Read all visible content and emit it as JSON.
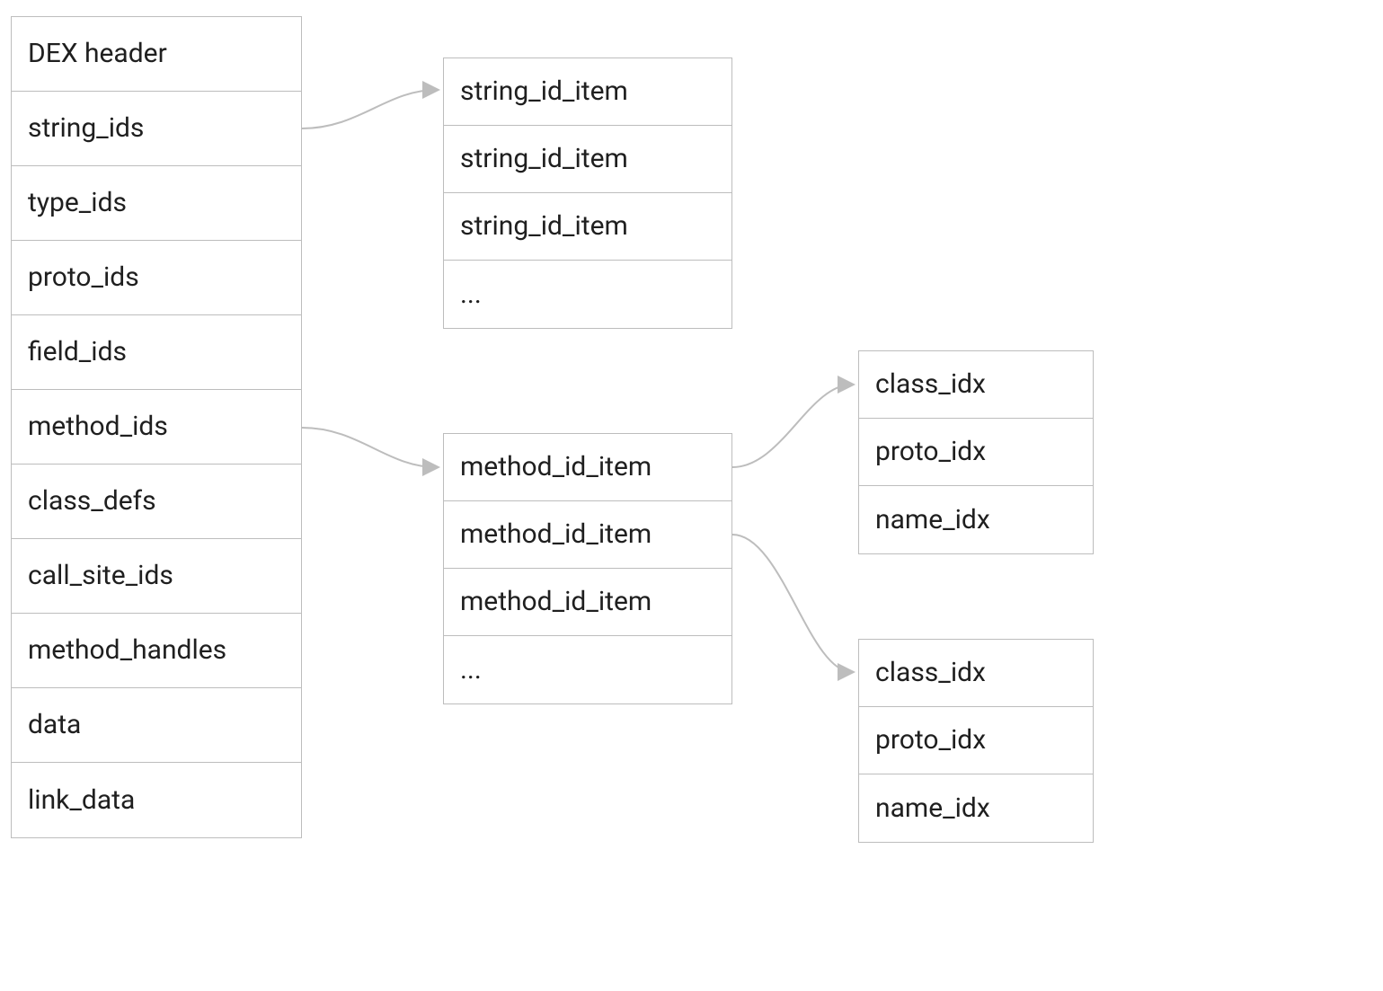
{
  "dex_sections": [
    "DEX header",
    "string_ids",
    "type_ids",
    "proto_ids",
    "field_ids",
    "method_ids",
    "class_defs",
    "call_site_ids",
    "method_handles",
    "data",
    "link_data"
  ],
  "string_id_list": [
    "string_id_item",
    "string_id_item",
    "string_id_item",
    "..."
  ],
  "method_id_list": [
    "method_id_item",
    "method_id_item",
    "method_id_item",
    "..."
  ],
  "method_detail_1": [
    "class_idx",
    "proto_idx",
    "name_idx"
  ],
  "method_detail_2": [
    "class_idx",
    "proto_idx",
    "name_idx"
  ]
}
